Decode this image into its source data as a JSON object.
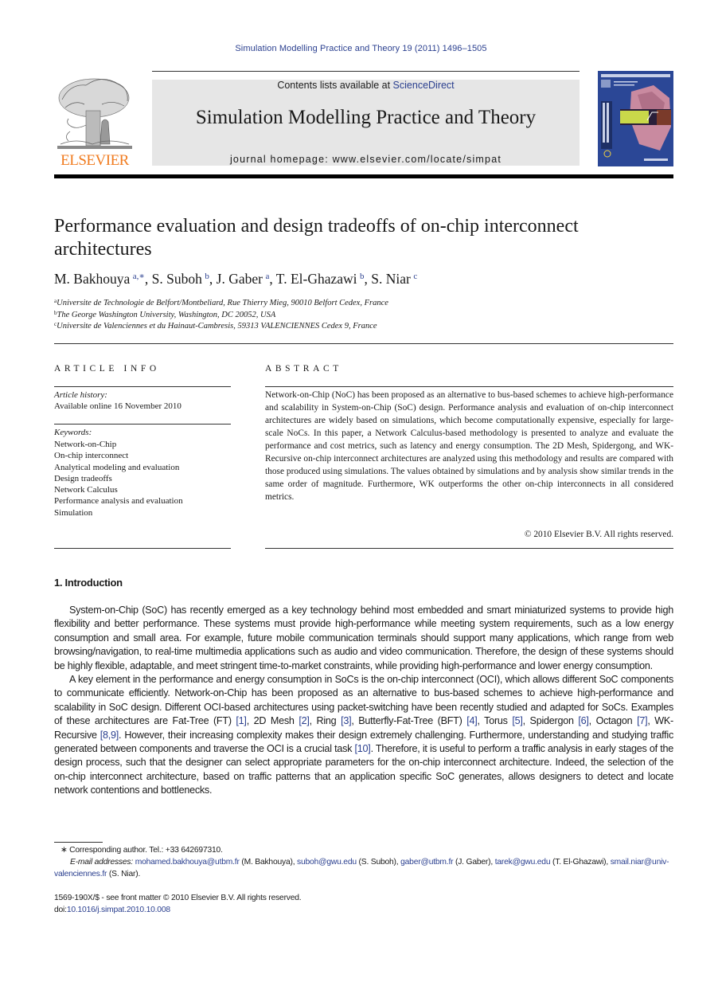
{
  "journal_ref": "Simulation Modelling Practice and Theory 19 (2011) 1496–1505",
  "header": {
    "publisher_logo_text": "ELSEVIER",
    "contents_prefix": "Contents lists available at ",
    "contents_link": "ScienceDirect",
    "journal_title": "Simulation Modelling Practice and Theory",
    "homepage": "journal homepage: www.elsevier.com/locate/simpat",
    "brand_color": "#f07b1f",
    "link_color": "#2a3f8f"
  },
  "article": {
    "title": "Performance evaluation and design tradeoffs of on-chip interconnect architectures",
    "authors": [
      {
        "name": "M. Bakhouya",
        "affil": "a,∗",
        "sep": ", "
      },
      {
        "name": "S. Suboh",
        "affil": "b",
        "sep": ", "
      },
      {
        "name": "J. Gaber",
        "affil": "a",
        "sep": ", "
      },
      {
        "name": "T. El-Ghazawi",
        "affil": "b",
        "sep": ", "
      },
      {
        "name": "S. Niar",
        "affil": "c",
        "sep": ""
      }
    ],
    "affiliations": [
      {
        "mark": "a",
        "text": "Universite de Technologie de Belfort/Montbeliard, Rue Thierry Mieg, 90010 Belfort Cedex, France"
      },
      {
        "mark": "b",
        "text": "The George Washington University, Washington, DC 20052, USA"
      },
      {
        "mark": "c",
        "text": "Universite de Valenciennes et du Hainaut-Cambresis, 59313 VALENCIENNES Cedex 9, France"
      }
    ]
  },
  "article_info": {
    "heading": "ARTICLE INFO",
    "history_label": "Article history:",
    "history_value": "Available online 16 November 2010",
    "keywords_label": "Keywords:",
    "keywords": [
      "Network-on-Chip",
      "On-chip interconnect",
      "Analytical modeling and evaluation",
      "Design tradeoffs",
      "Network Calculus",
      "Performance analysis and evaluation",
      "Simulation"
    ]
  },
  "abstract": {
    "heading": "ABSTRACT",
    "text": "Network-on-Chip (NoC) has been proposed as an alternative to bus-based schemes to achieve high-performance and scalability in System-on-Chip (SoC) design. Performance analysis and evaluation of on-chip interconnect architectures are widely based on simula­tions, which become computationally expensive, especially for large-scale NoCs. In this paper, a Network Calculus-based methodology is presented to analyze and evaluate the performance and cost metrics, such as latency and energy consumption. The 2D Mesh, Spidergong, and WK-Recursive on-chip interconnect architectures are analyzed using this methodology and results are compared with those produced using simulations. The values obtained by simulations and by analysis show similar trends in the same order of magni­tude. Furthermore, WK outperforms the other on-chip interconnects in all considered metrics.",
    "copyright": "© 2010 Elsevier B.V. All rights reserved."
  },
  "introduction": {
    "heading": "1. Introduction",
    "para1": "System-on-Chip (SoC) has recently emerged as a key technology behind most embedded and smart miniaturized systems to provide high flexibility and better performance. These systems must provide high-performance while meeting system requirements, such as a low energy consumption and small area. For example, future mobile communication terminals should support many applications, which range from web browsing/navigation, to real-time multimedia applications such as audio and video communication. Therefore, the design of these systems should be highly flexible, adaptable, and meet stringent time-to-market constraints, while providing high-performance and lower energy consumption.",
    "para2_segments": [
      {
        "t": "A key element in the performance and energy consumption in SoCs is the on-chip interconnect (OCI), which allows dif­ferent SoC components to communicate efficiently. Network-on-Chip has been proposed as an alternative to bus-based schemes to achieve high-performance and scalability in SoC design. Different OCI-based architectures using packet-switch­ing have been recently studied and adapted for SoCs. Examples of these architectures are Fat-Tree (FT) "
      },
      {
        "ref": "[1]"
      },
      {
        "t": ", 2D Mesh "
      },
      {
        "ref": "[2]"
      },
      {
        "t": ", Ring "
      },
      {
        "ref": "[3]"
      },
      {
        "t": ", Butterfly-Fat-Tree (BFT) "
      },
      {
        "ref": "[4]"
      },
      {
        "t": ", Torus "
      },
      {
        "ref": "[5]"
      },
      {
        "t": ", Spidergon "
      },
      {
        "ref": "[6]"
      },
      {
        "t": ", Octagon "
      },
      {
        "ref": "[7]"
      },
      {
        "t": ", WK-Recursive "
      },
      {
        "ref": "[8,9]"
      },
      {
        "t": ". However, their increasing com­plexity makes their design extremely challenging. Furthermore, understanding and studying traffic generated between com­ponents and traverse the OCI is a crucial task "
      },
      {
        "ref": "[10]"
      },
      {
        "t": ". Therefore, it is useful to perform a traffic analysis in early stages of the design process, such that the designer can select appropriate parameters for the on-chip interconnect architecture. Indeed, the selection of the on-chip interconnect architecture, based on traffic patterns that an application specific SoC generates, allows designers to detect and locate network contentions and bottlenecks."
      }
    ]
  },
  "footnotes": {
    "corresponding": "∗ Corresponding author. Tel.: +33 642697310.",
    "email_label": "E-mail addresses:",
    "emails": [
      {
        "email": "mohamed.bakhouya@utbm.fr",
        "who": " (M. Bakhouya), "
      },
      {
        "email": "suboh@gwu.edu",
        "who": " (S. Suboh), "
      },
      {
        "email": "gaber@utbm.fr",
        "who": " (J. Gaber), "
      },
      {
        "email": "tarek@gwu.edu",
        "who": " (T. El-Ghazawi), "
      },
      {
        "email": "smail.niar@univ-valenciennes.fr",
        "who": " (S. Niar)."
      }
    ],
    "issn": "1569-190X/$ - see front matter © 2010 Elsevier B.V. All rights reserved.",
    "doi_label": "doi:",
    "doi": "10.1016/j.simpat.2010.10.008"
  }
}
